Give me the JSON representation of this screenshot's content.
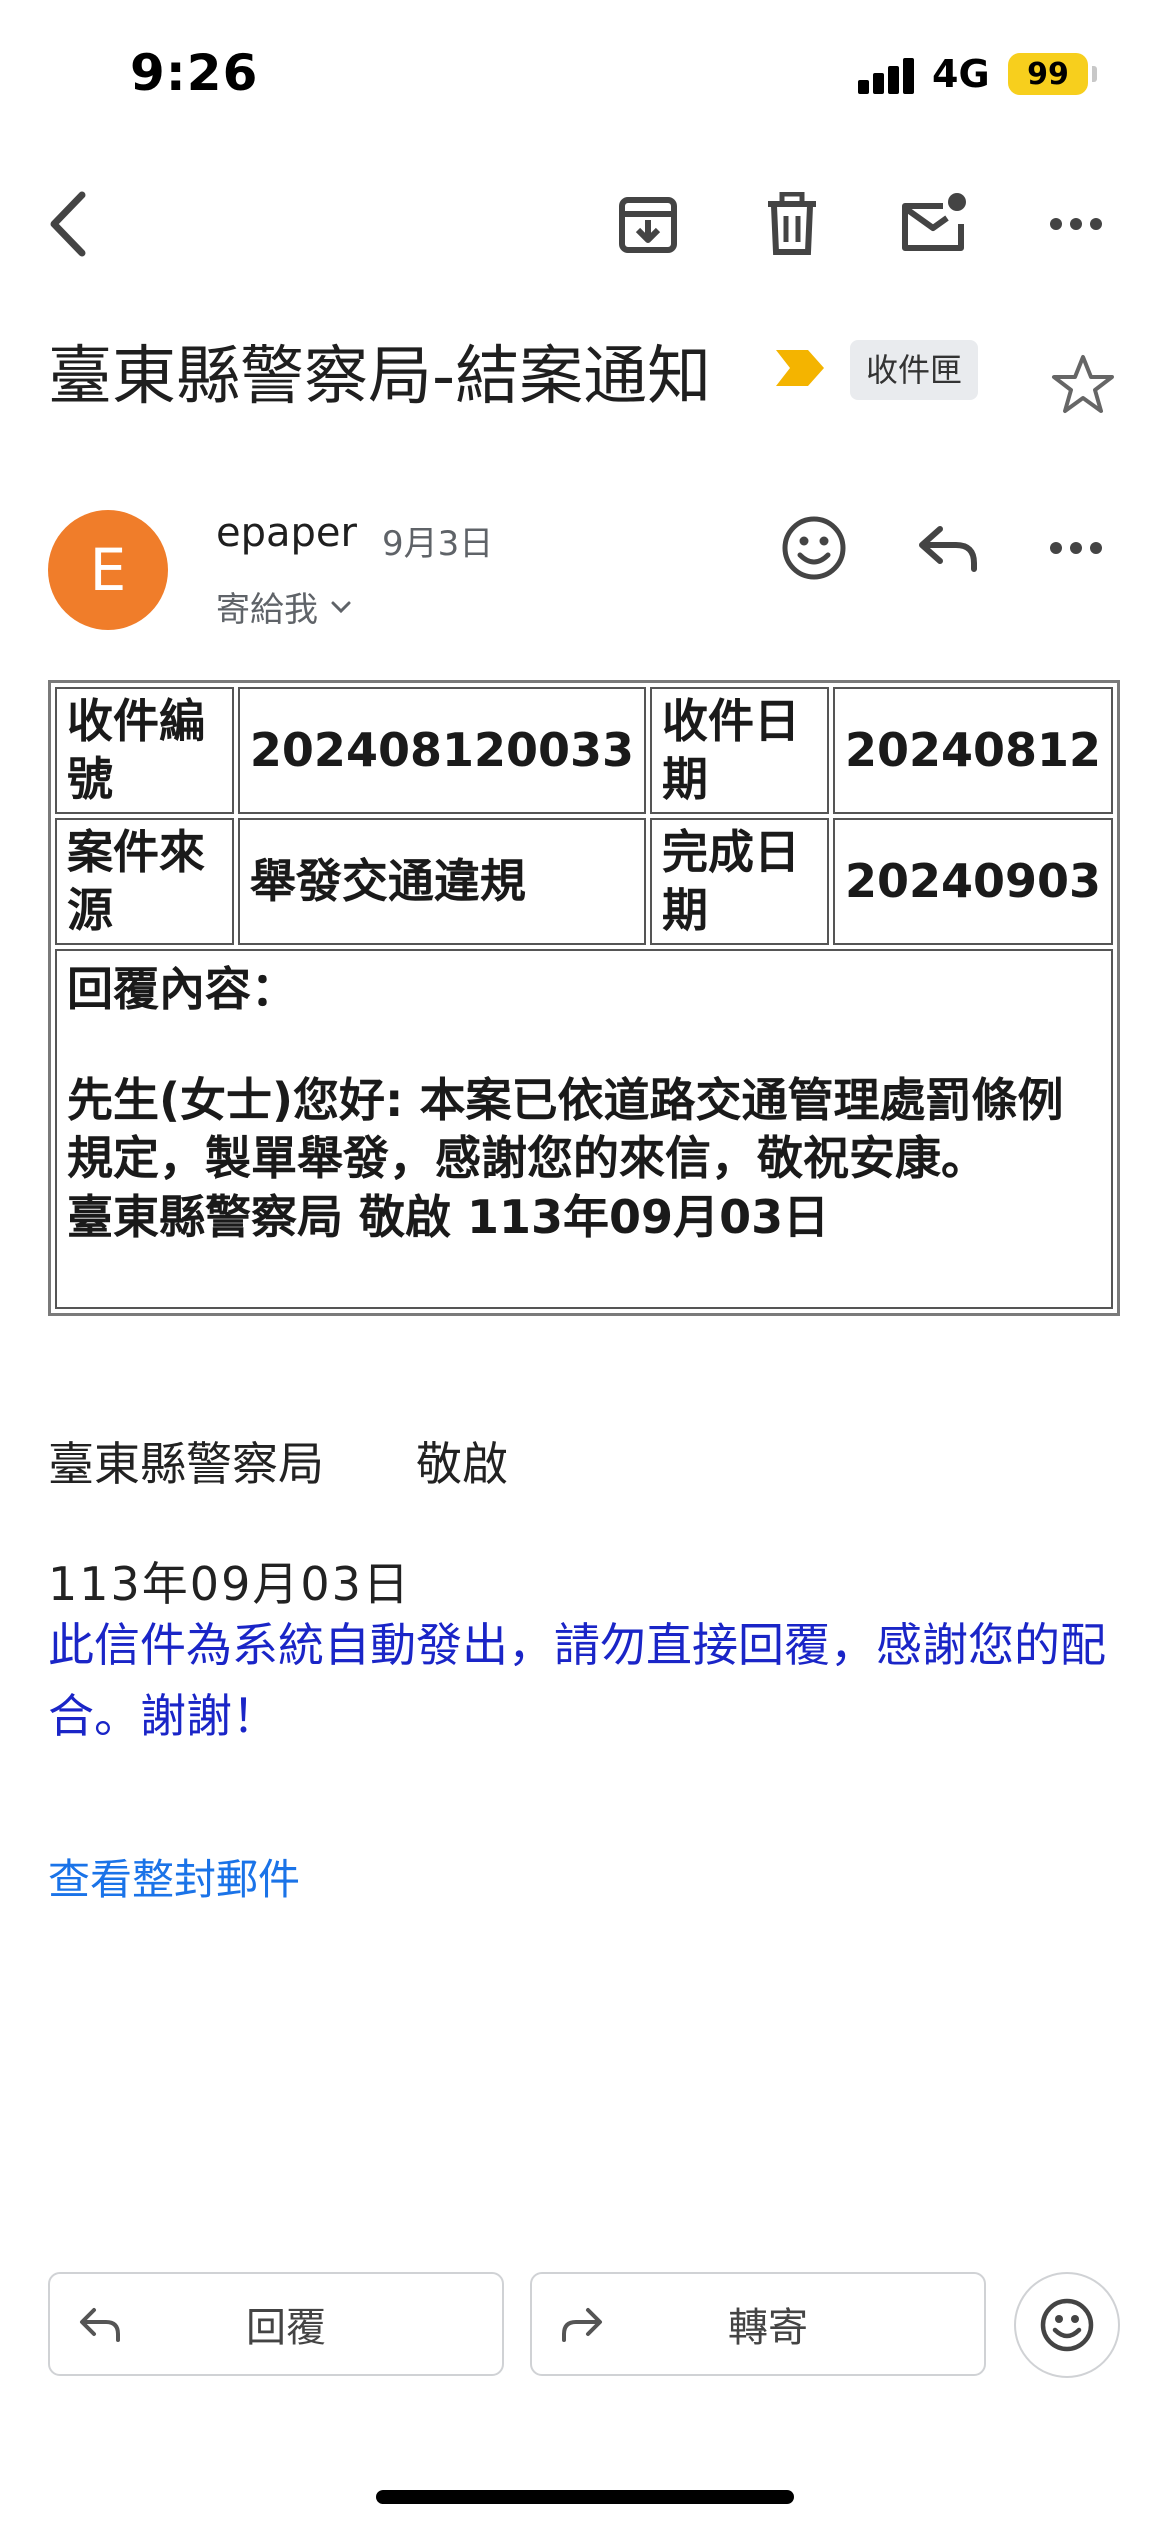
{
  "status_bar": {
    "time": "9:26",
    "network": "4G",
    "battery": "99",
    "battery_color": "#f7cf1d"
  },
  "toolbar": {
    "back_icon": "back-arrow-icon",
    "archive_icon": "archive-icon",
    "delete_icon": "trash-icon",
    "unread_icon": "mark-unread-icon",
    "more_icon": "more-horizontal-icon"
  },
  "email": {
    "subject": "臺東縣警察局-結案通知",
    "label": "收件匣",
    "important_color": "#f4b400",
    "sender": {
      "initial": "E",
      "name": "epaper",
      "date": "9月3日",
      "recipient": "寄給我",
      "avatar_color": "#f07d2a"
    }
  },
  "case_table": {
    "row1": {
      "label1": "收件編號",
      "value1": "202408120033",
      "label2": "收件日期",
      "value2": "20240812"
    },
    "row2": {
      "label1": "案件來源",
      "value1": "舉發交通違規",
      "label2": "完成日期",
      "value2": "20240903"
    },
    "reply_label": "回覆內容：",
    "reply_body": "先生(女士)您好: 本案已依道路交通管理處罰條例規定，製單舉發，感謝您的來信，敬祝安康。",
    "reply_signature": "臺東縣警察局 敬啟 113年09月03日"
  },
  "footer": {
    "sign": "臺東縣警察局　　敬啟",
    "date": "113年09月03日",
    "notice": "此信件為系統自動發出，請勿直接回覆，感謝您的配合。謝謝！",
    "notice_color": "#1a25c7",
    "view_all": "查看整封郵件"
  },
  "actions": {
    "reply": "回覆",
    "forward": "轉寄"
  }
}
